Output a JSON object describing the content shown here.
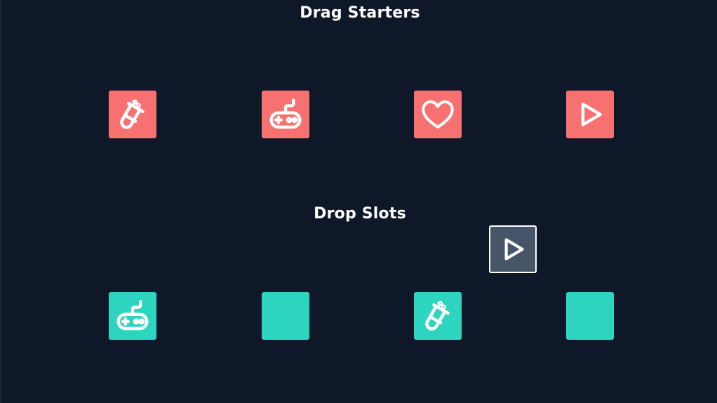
{
  "titles": {
    "drag_starters": "Drag Starters",
    "drop_slots": "Drop Slots"
  },
  "colors": {
    "background": "#0f1829",
    "starter": "#f87171",
    "slot": "#2dd4bf",
    "drag_ghost": "#475569",
    "icon": "#ffffff"
  },
  "drag_starters": [
    {
      "icon": "flask-icon"
    },
    {
      "icon": "gamepad-icon"
    },
    {
      "icon": "heart-icon"
    },
    {
      "icon": "play-icon"
    }
  ],
  "drop_slots": [
    {
      "icon": "gamepad-icon",
      "filled": true
    },
    {
      "icon": null,
      "filled": false
    },
    {
      "icon": "flask-icon",
      "filled": true
    },
    {
      "icon": null,
      "filled": false
    }
  ],
  "dragging": {
    "icon": "play-icon"
  }
}
